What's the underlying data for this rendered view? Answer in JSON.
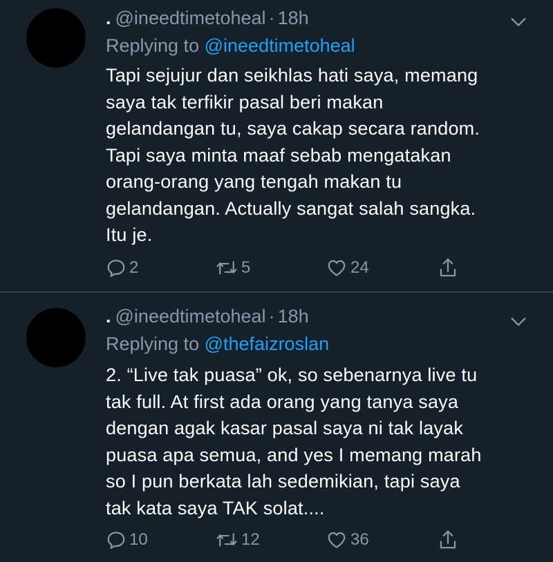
{
  "colors": {
    "background": "#15202b",
    "divider": "#38444d",
    "secondary_text": "#8899a6",
    "mention": "#1da1f2",
    "primary_text": "#ffffff"
  },
  "tweets": [
    {
      "display_name": ".",
      "handle": "@ineedtimetoheal",
      "separator": "·",
      "time": "18h",
      "replying_prefix": "Replying to",
      "replying_to": "@ineedtimetoheal",
      "text": "Tapi sejujur dan seikhlas hati saya, memang\nsaya tak terfikir pasal beri makan\ngelandangan tu, saya cakap secara random.\nTapi saya minta maaf sebab mengatakan\norang-orang yang tengah makan tu\ngelandangan. Actually sangat salah sangka.\nItu je.",
      "reply_count": "2",
      "retweet_count": "5",
      "like_count": "24",
      "icons": [
        "reply-icon",
        "retweet-icon",
        "like-icon",
        "share-icon",
        "chevron-down-icon"
      ]
    },
    {
      "display_name": ".",
      "handle": "@ineedtimetoheal",
      "separator": "·",
      "time": "18h",
      "replying_prefix": "Replying to",
      "replying_to": "@thefaizroslan",
      "text": "2. “Live tak puasa” ok, so sebenarnya live tu\ntak full. At first ada orang yang tanya saya\ndengan agak kasar pasal saya ni tak layak\npuasa apa semua, and yes I memang marah\nso I pun berkata lah sedemikian, tapi saya\ntak kata saya TAK solat....",
      "reply_count": "10",
      "retweet_count": "12",
      "like_count": "36",
      "icons": [
        "reply-icon",
        "retweet-icon",
        "like-icon",
        "share-icon",
        "chevron-down-icon"
      ]
    }
  ]
}
